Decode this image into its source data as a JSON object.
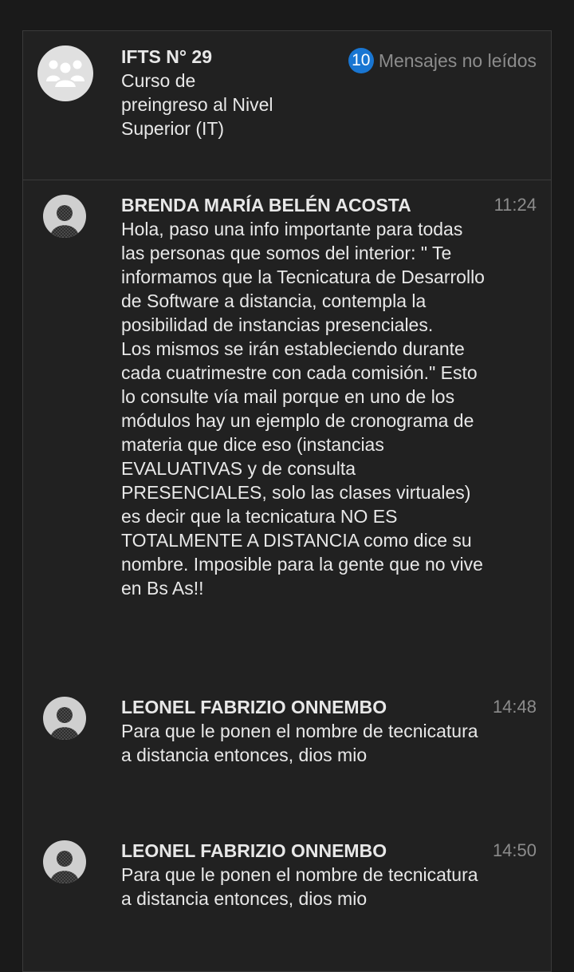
{
  "group": {
    "name": "IFTS N° 29",
    "description": "Curso de preingreso al Nivel Superior (IT)",
    "unread_count": "10",
    "unread_label": "Mensajes no leídos",
    "avatar_icon": "group-people-icon"
  },
  "messages": [
    {
      "sender": "BRENDA MARÍA BELÉN ACOSTA",
      "time": "11:24",
      "text": "Hola, paso una info importante para todas las personas que somos del interior: \" Te informamos que la Tecnicatura de Desarrollo de Software a distancia, contempla la posibilidad de instancias presenciales.\nLos mismos se irán estableciendo durante cada cuatrimestre con cada comisión.\" Esto lo consulte vía mail porque en uno de los módulos hay un ejemplo de cronograma de materia que dice eso (instancias EVALUATIVAS y de consulta PRESENCIALES, solo las clases virtuales) es decir que la tecnicatura NO ES TOTALMENTE A DISTANCIA como dice su nombre. Imposible para la gente que no vive en Bs As!!",
      "avatar_icon": "user-avatar-icon"
    },
    {
      "sender": "LEONEL FABRIZIO ONNEMBO",
      "time": "14:48",
      "text": "Para que le ponen el nombre de tecnicatura a distancia entonces, dios mio",
      "avatar_icon": "user-avatar-icon"
    },
    {
      "sender": "LEONEL FABRIZIO ONNEMBO",
      "time": "14:50",
      "text": "Para que le ponen el nombre de tecnicatura a distancia entonces, dios mio",
      "avatar_icon": "user-avatar-icon"
    }
  ],
  "colors": {
    "background": "#1a1a1a",
    "panel": "#212121",
    "text": "#e8e8e8",
    "muted": "#8c8c8c",
    "badge": "#1976d2"
  }
}
